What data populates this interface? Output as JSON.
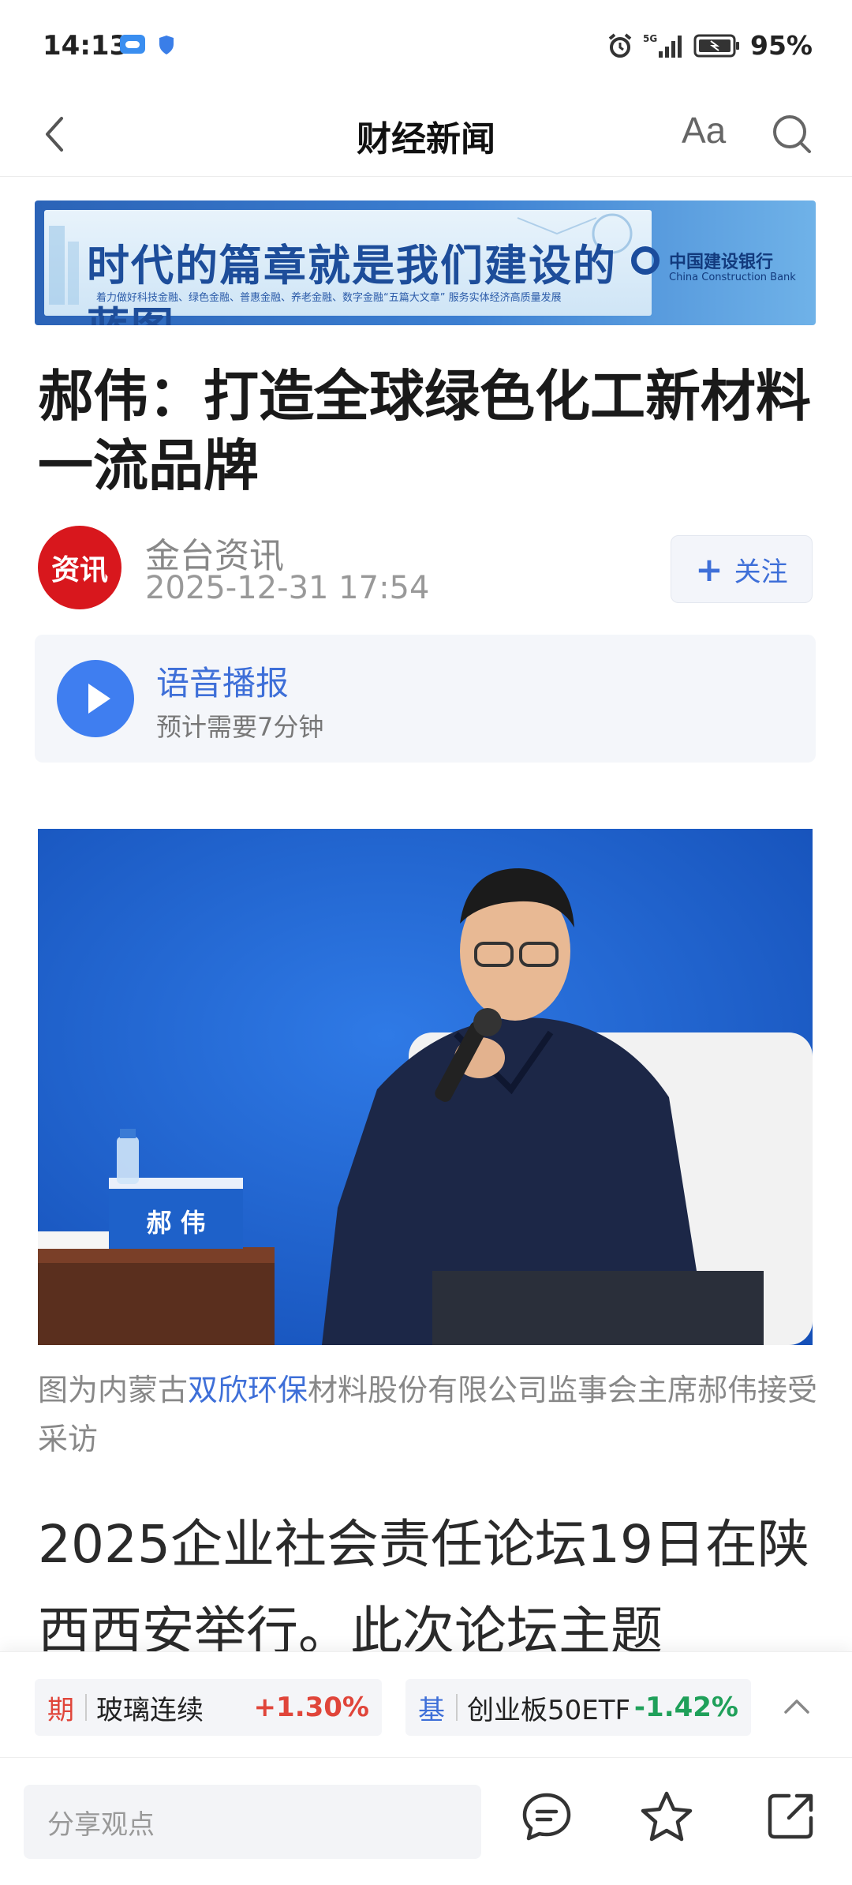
{
  "status_bar": {
    "time": "14:13",
    "network": "5G",
    "battery": "95%"
  },
  "header": {
    "title": "财经新闻",
    "font_button": "Aa"
  },
  "banner": {
    "headline": "时代的篇章就是我们建设的蓝图",
    "subline": "着力做好科技金融、绿色金融、普惠金融、养老金融、数字金融“五篇大文章” 服务实体经济高质量发展",
    "bank_name_cn": "中国建设银行",
    "bank_name_en": "China Construction Bank",
    "accent_color": "#2b63b7"
  },
  "article": {
    "title": "郝伟：打造全球绿色化工新材料一流品牌",
    "author": {
      "avatar_text": "资讯",
      "name": "金台资讯",
      "date": "2025-12-31 17:54",
      "follow_label": "关注"
    },
    "audio": {
      "title": "语音播报",
      "duration": "预计需要7分钟"
    },
    "photo": {
      "nameplate": "郝 伟"
    },
    "caption": {
      "prefix": "图为内蒙古",
      "link": "双欣环保",
      "suffix": "材料股份有限公司监事会主席郝伟接受采访"
    },
    "body": "2025企业社会责任论坛19日在陕西西安举行。此次论坛主题"
  },
  "tickers": [
    {
      "tag": "期",
      "name": "玻璃连续",
      "change": "+1.30%",
      "direction": "up"
    },
    {
      "tag": "基",
      "name": "创业板50ETF",
      "change": "-1.42%",
      "direction": "down"
    }
  ],
  "bottom_bar": {
    "share_placeholder": "分享观点"
  },
  "colors": {
    "accent_blue": "#3e6fd8",
    "up_red": "#e0453a",
    "down_green": "#1fa05a",
    "avatar_red": "#d8171d"
  }
}
